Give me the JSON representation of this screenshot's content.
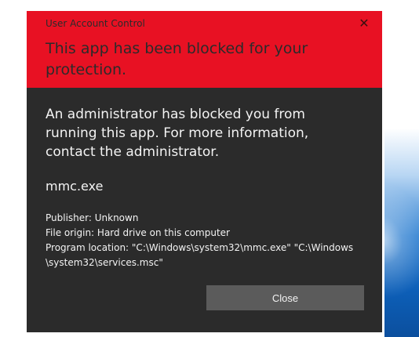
{
  "window": {
    "title": "User Account Control",
    "close_glyph": "✕",
    "close_icon": "close-icon"
  },
  "dialog": {
    "heading": "This app has been blocked for your protection.",
    "message": "An administrator has blocked you from running this app. For more information, contact the administrator.",
    "app_name": "mmc.exe",
    "publisher": "Publisher: Unknown",
    "file_origin": "File origin: Hard drive on this computer",
    "program_location_line1": "Program location: \"C:\\Windows\\system32\\mmc.exe\" \"C:\\Windows",
    "program_location_line2": "\\system32\\services.msc\"",
    "close_button_label": "Close"
  },
  "colors": {
    "header_red": "#e81123",
    "dialog_dark": "#2b2b2b",
    "button_gray": "#5b5b5b"
  }
}
